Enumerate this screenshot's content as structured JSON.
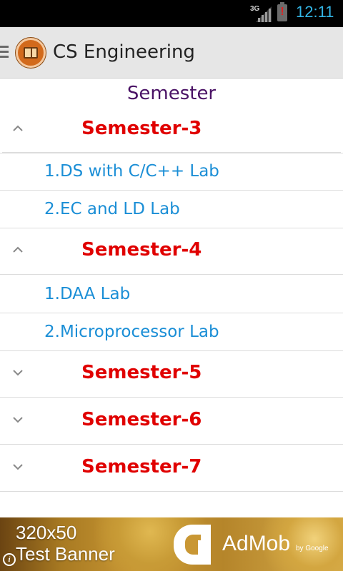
{
  "status_bar": {
    "network_type": "3G",
    "time": "12:11",
    "battery_alert": "!"
  },
  "action_bar": {
    "title": "CS Engineering",
    "app_icon": "book-icon",
    "nav_icon": "drawer-indicator-icon"
  },
  "content": {
    "heading": "Semester",
    "groups": [
      {
        "label": "Semester-3",
        "expanded": true,
        "children": [
          "1.DS with C/C++ Lab",
          "2.EC and LD Lab"
        ]
      },
      {
        "label": "Semester-4",
        "expanded": true,
        "children": [
          "1.DAA Lab",
          "2.Microprocessor Lab"
        ]
      },
      {
        "label": "Semester-5",
        "expanded": false,
        "children": []
      },
      {
        "label": "Semester-6",
        "expanded": false,
        "children": []
      },
      {
        "label": "Semester-7",
        "expanded": false,
        "children": []
      }
    ]
  },
  "ad": {
    "line1": "320x50",
    "line2": "Test Banner",
    "brand": "AdMob",
    "brand_by": "by Google",
    "info_glyph": "i"
  },
  "colors": {
    "heading": "#4a1265",
    "group_label": "#e00000",
    "child_label": "#1a8ed6",
    "clock": "#33b5e5"
  }
}
